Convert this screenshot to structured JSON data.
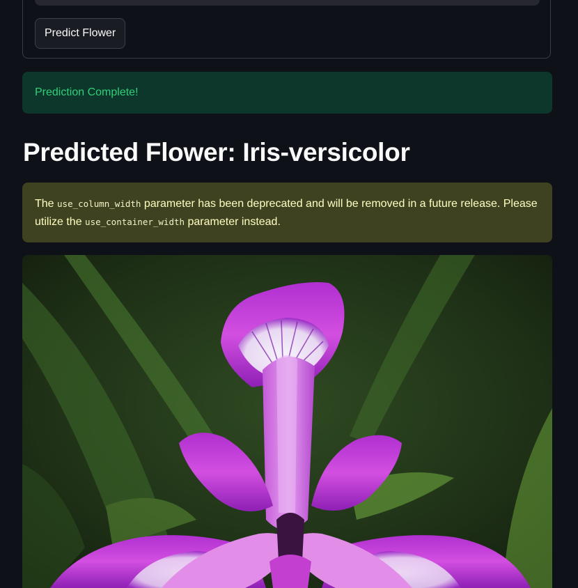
{
  "form": {
    "predict_button_label": "Predict Flower"
  },
  "status": {
    "message": "Prediction Complete!",
    "color": "#2fd07a"
  },
  "result": {
    "heading": "Predicted Flower: Iris-versicolor"
  },
  "warning": {
    "text_1": "The ",
    "code_1": "use_column_width",
    "text_2": " parameter has been deprecated and will be removed in a future release. Please utilize the ",
    "code_2": "use_container_width",
    "text_3": " parameter instead."
  },
  "image": {
    "subject": "iris-versicolor-flower-photo"
  },
  "colors": {
    "background": "#0e1117",
    "success_bg": "#0c372a",
    "warning_bg": "#3f4220",
    "warning_text": "#ffffc2"
  }
}
